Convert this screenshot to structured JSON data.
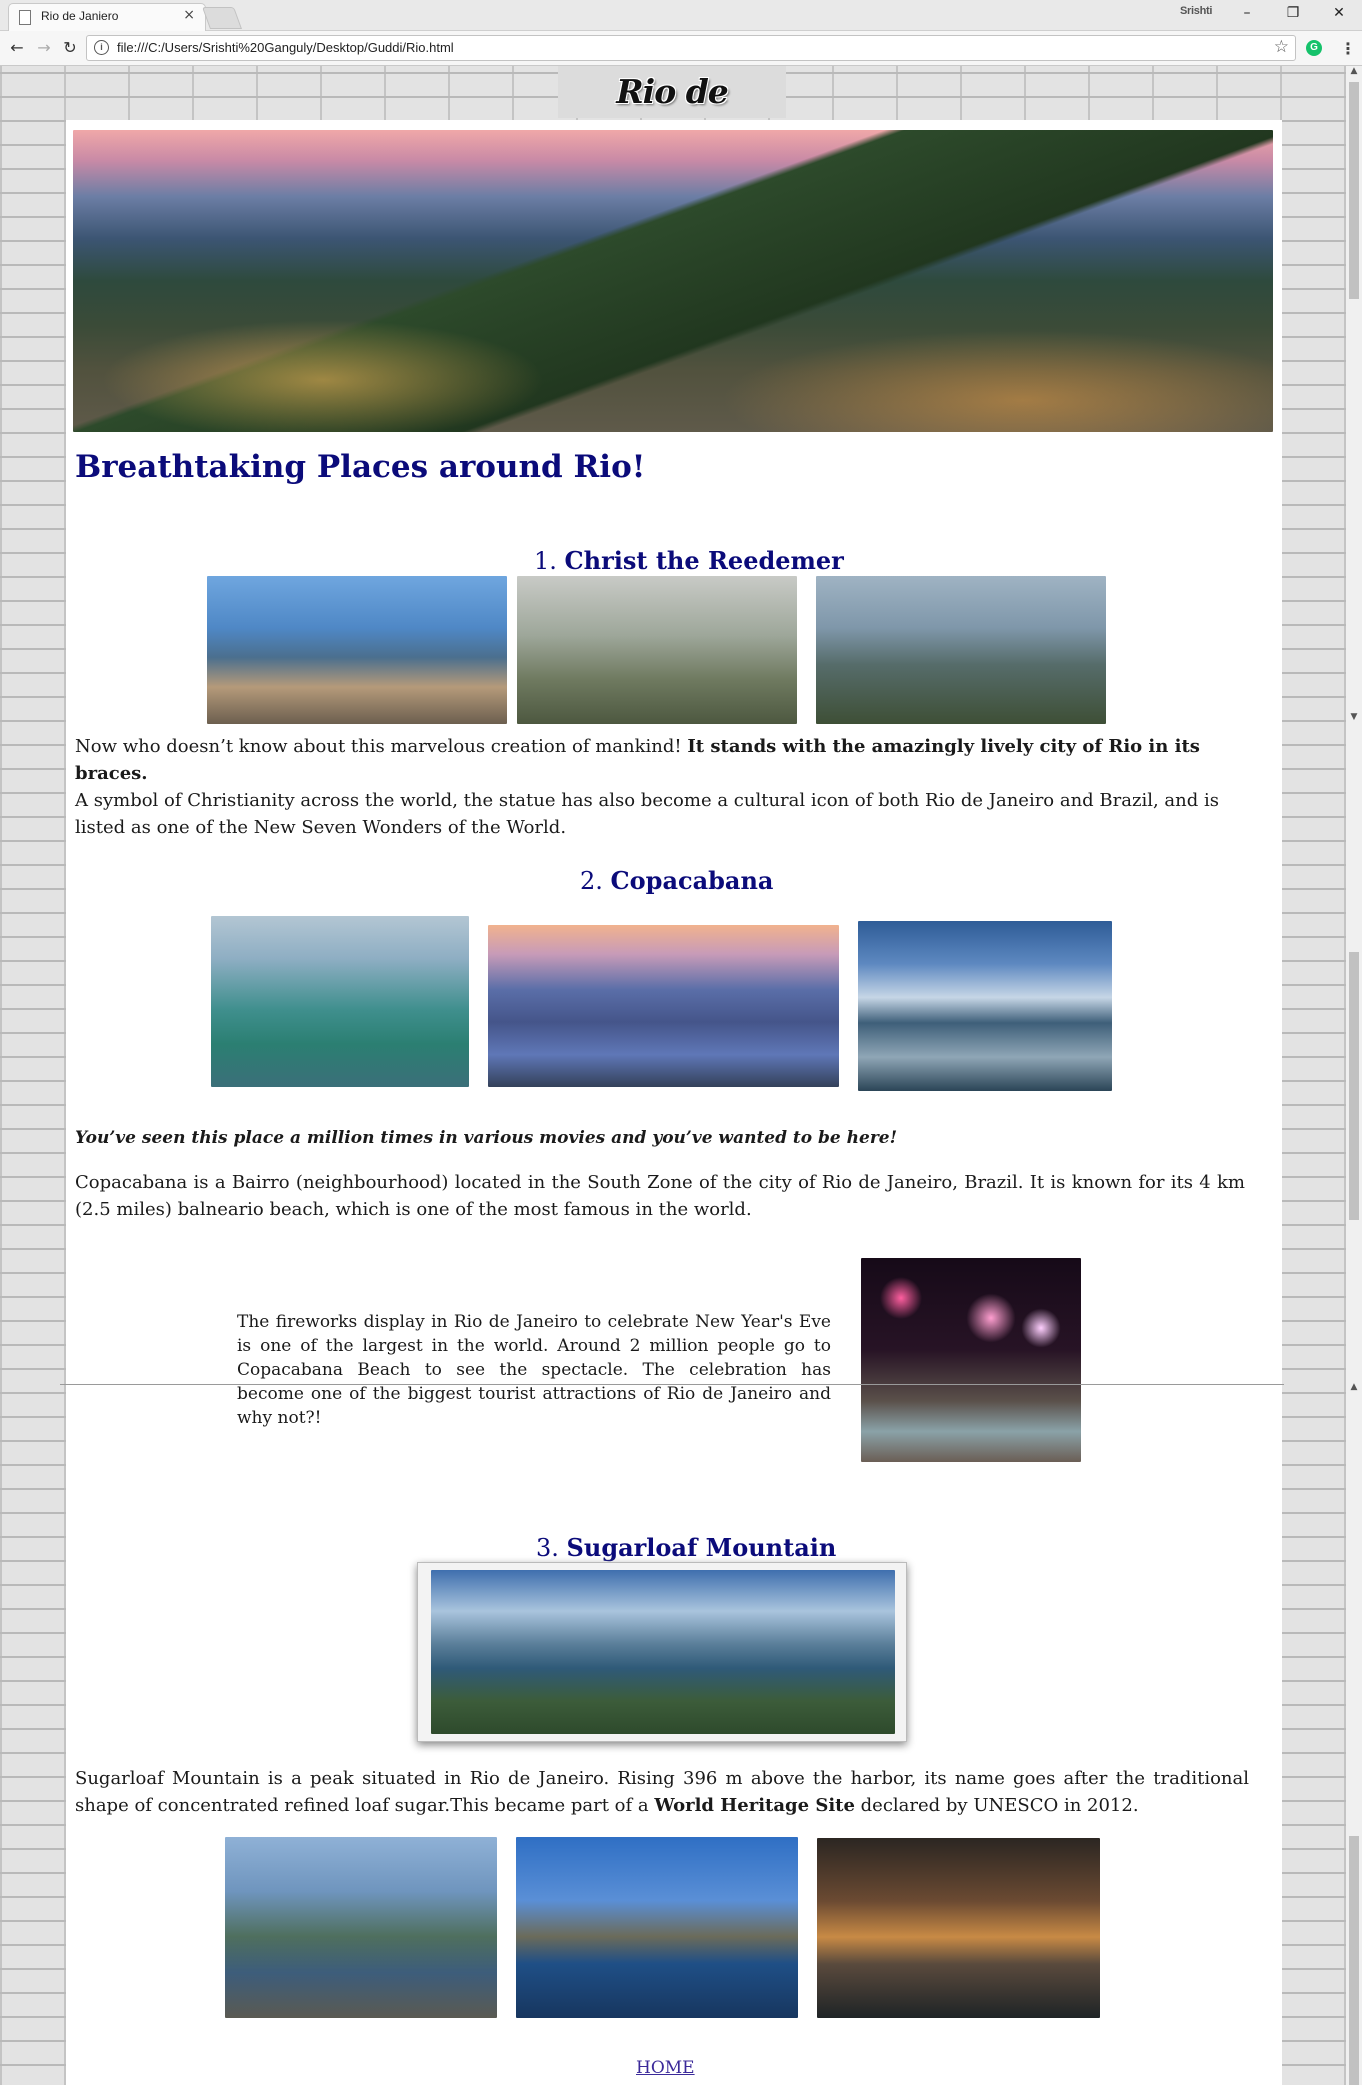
{
  "browser": {
    "tab_title": "Rio de Janiero",
    "tab_close": "×",
    "user": "Srishti",
    "minimize": "–",
    "restore": "❐",
    "close": "✕",
    "back": "←",
    "forward": "→",
    "reload": "↻",
    "info": "i",
    "url": "file:///C:/Users/Srishti%20Ganguly/Desktop/Guddi/Rio.html",
    "star": "☆",
    "extension": "G",
    "menu": "⋮"
  },
  "page": {
    "banner_title": "Rio de Janeiro",
    "heading": "Breathtaking Places around Rio!",
    "sections": [
      {
        "number": "1.",
        "title": "Christ the Reedemer",
        "text_plain": "Now who doesn’t know about this marvelous creation of mankind! ",
        "text_bold": "It stands with the amazingly lively city of Rio in its braces.",
        "text_more": "A symbol of Christianity across the world, the statue has also become a cultural icon of both Rio de Janeiro and Brazil, and is listed as one of the New Seven Wonders of the World."
      },
      {
        "number": "2.",
        "title": "Copacabana",
        "tagline": "You’ve seen this place a million times in various movies and you’ve wanted to be here!",
        "text": "Copacabana is a Bairro (neighbourhood) located in the South Zone of the city of Rio de Janeiro, Brazil. It is known for its 4 km (2.5 miles) balneario beach, which is one of the most famous in the world.",
        "fireworks_text": "The fireworks display in Rio de Janeiro to celebrate New Year's Eve is one of the largest in the world. Around 2 million people go to Copacabana Beach to see the spectacle. The celebration has become one of the biggest tourist attractions of Rio de Janeiro and why not?!"
      },
      {
        "number": "3.",
        "title": "Sugarloaf Mountain",
        "text_plain": "Sugarloaf Mountain is a peak situated in Rio de Janeiro. Rising 396 m above the harbor, its name goes after the traditional shape of concentrated refined loaf sugar.This became part of a ",
        "text_bold": "World Heritage Site",
        "text_end": " declared by UNESCO in 2012."
      }
    ],
    "home_link": "HOME"
  },
  "colors": {
    "heading": "#0b0b7a",
    "link": "#3b2a9a"
  }
}
